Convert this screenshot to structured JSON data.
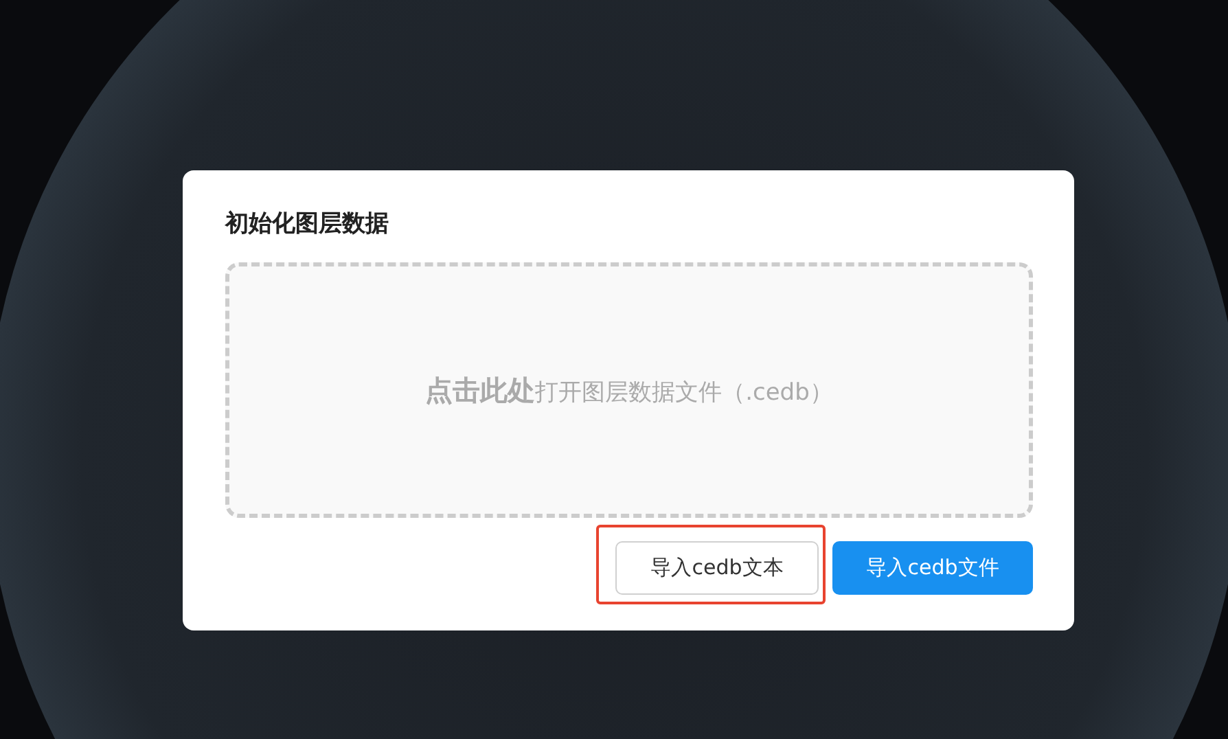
{
  "dialog": {
    "title": "初始化图层数据",
    "dropzone": {
      "text": "**点击此处**打开图层数据文件（.cedb）"
    },
    "buttons": [
      {
        "label": "导入cedb文本",
        "kind": "default",
        "highlighted": true
      },
      {
        "label": "导入cedb文件",
        "kind": "primary",
        "highlighted": false
      }
    ]
  }
}
